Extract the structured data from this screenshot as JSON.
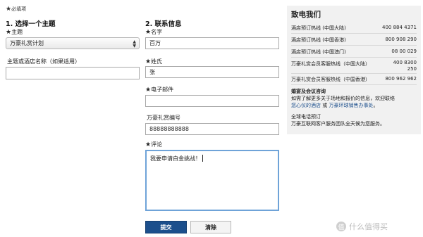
{
  "required_note": "必填项",
  "section1": {
    "title": "1. 选择一个主题",
    "topic_label": "主题",
    "topic_value": "万豪礼赏计划",
    "hotel_label": "主题或酒店名称（如果适用）",
    "hotel_value": ""
  },
  "section2": {
    "title": "2. 联系信息",
    "first_name_label": "名字",
    "first_name_value": "百万",
    "last_name_label": "姓氏",
    "last_name_value": "张",
    "email_label": "电子邮件",
    "email_value": "",
    "rewards_label": "万豪礼赏编号",
    "rewards_value": "88888888888",
    "comment_label": "评论",
    "comment_value": "我要申请白金挑战！"
  },
  "buttons": {
    "submit": "提交",
    "clear": "清除"
  },
  "contact": {
    "title": "致电我们",
    "rows": [
      {
        "label": "酒店预订热线 (中国大陆)",
        "value": "400 884 4371"
      },
      {
        "label": "酒店预订热线 (中国香港)",
        "value": "800 908 290"
      },
      {
        "label": "酒店预订热线 (中国澳门)",
        "value": "08 00 029"
      },
      {
        "label": "万豪礼赏会员客服热线（中国大陆）",
        "value_line1": "400 8300",
        "value_line2": "250"
      },
      {
        "label": "万豪礼赏会员客服热线（中国香港）",
        "value": "800 962 962"
      }
    ],
    "wedding_title": "婚宴及会议咨询",
    "wedding_text1": "如需了解更多关于场地和报价的信息，欢迎联络",
    "wedding_link1": "您心仪的酒店",
    "wedding_or": " 或 ",
    "wedding_link2": "万豪环球销售办事处",
    "wedding_end": "。",
    "global_link": "全球电话预订",
    "global_text": "万豪互联网客户服务团队全天候为您服务。"
  },
  "watermark": {
    "badge": "值",
    "text": "什么值得买"
  }
}
